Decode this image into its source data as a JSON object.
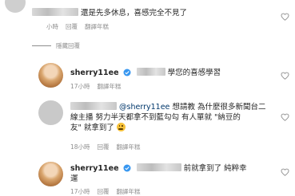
{
  "comment1": {
    "text": "還是先多休息，喜感完全不見了",
    "time": "小時",
    "reply": "回覆",
    "translate": "翻譯年糕"
  },
  "hide_replies": "隱藏回覆",
  "reply1": {
    "username": "sherry11ee",
    "text": "學您的喜感學習",
    "time": "17小時",
    "translate": "翻譯年糕"
  },
  "reply2": {
    "mention": "@sherry11ee",
    "line1": "想請教 為什麼很多新聞台二",
    "line2": "線主播 努力半天都拿不到藍勾勾 有人單就 \"納豆的",
    "line3": "友\" 就拿到了",
    "time": "18小時",
    "reply": "回覆",
    "translate": "翻譯年糕"
  },
  "reply3": {
    "username": "sherry11ee",
    "line1": "前就拿到了 純粹幸",
    "line2": "運",
    "time": "17小時",
    "reply": "回覆",
    "translate": "翻譯年糕"
  },
  "colors": {
    "meta": "#8e8e8e",
    "text": "#262626",
    "verified": "#3897f0",
    "mention": "#00376b"
  }
}
